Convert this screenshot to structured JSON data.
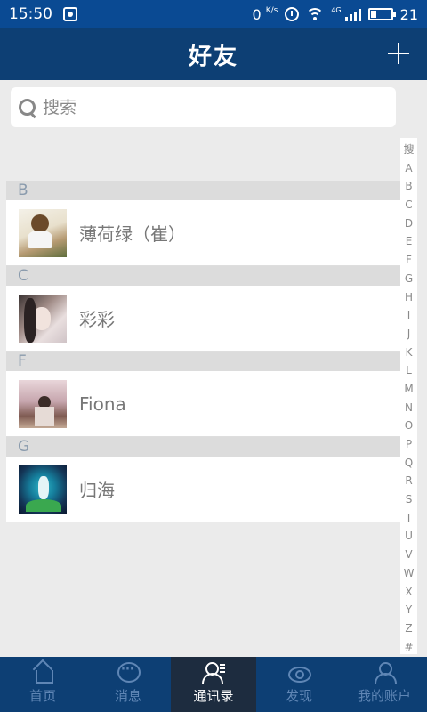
{
  "status_bar": {
    "time": "15:50",
    "net_speed": "0",
    "net_unit": "K/s",
    "network_type": "4G",
    "battery": "21"
  },
  "header": {
    "title": "好友",
    "add_icon": "plus-icon"
  },
  "search": {
    "placeholder": "搜索",
    "icon": "search-icon"
  },
  "sections": [
    {
      "letter": "B",
      "contacts": [
        {
          "name": "薄荷绿（崔）"
        }
      ]
    },
    {
      "letter": "C",
      "contacts": [
        {
          "name": "彩彩"
        }
      ]
    },
    {
      "letter": "F",
      "contacts": [
        {
          "name": "Fiona"
        }
      ]
    },
    {
      "letter": "G",
      "contacts": [
        {
          "name": "归海"
        }
      ]
    }
  ],
  "index_bar": [
    "搜",
    "A",
    "B",
    "C",
    "D",
    "E",
    "F",
    "G",
    "H",
    "I",
    "J",
    "K",
    "L",
    "M",
    "N",
    "O",
    "P",
    "Q",
    "R",
    "S",
    "T",
    "U",
    "V",
    "W",
    "X",
    "Y",
    "Z",
    "#"
  ],
  "tabs": [
    {
      "label": "首页",
      "icon": "home-icon",
      "active": false
    },
    {
      "label": "消息",
      "icon": "message-icon",
      "active": false
    },
    {
      "label": "通讯录",
      "icon": "contacts-icon",
      "active": true
    },
    {
      "label": "发现",
      "icon": "discover-icon",
      "active": false
    },
    {
      "label": "我的账户",
      "icon": "account-icon",
      "active": false
    }
  ],
  "colors": {
    "status_bar": "#0a4a93",
    "header": "#0d3f74",
    "tab_active": "#1d2c3f",
    "background": "#ebebeb"
  }
}
